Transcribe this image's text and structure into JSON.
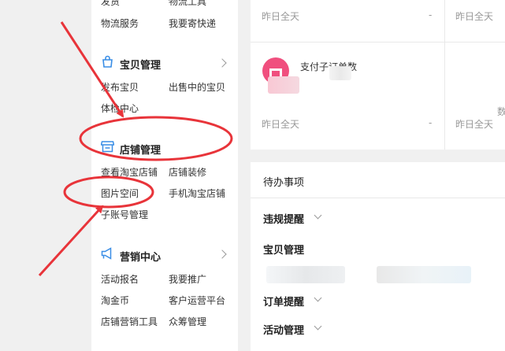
{
  "sidebar": {
    "top_row": {
      "left": "发货",
      "right": "物流工具"
    },
    "logistics_row": {
      "left": "物流服务",
      "right": "我要寄快递"
    },
    "product_mgmt": {
      "title": "宝贝管理",
      "links": [
        "发布宝贝",
        "出售中的宝贝",
        "体检中心"
      ]
    },
    "store_mgmt": {
      "title": "店铺管理",
      "links": [
        "查看淘宝店铺",
        "店铺装修",
        "图片空间",
        "手机淘宝店铺",
        "子账号管理"
      ]
    },
    "marketing": {
      "title": "营销中心",
      "links": [
        "活动报名",
        "我要推广",
        "淘金币",
        "客户运营平台",
        "店铺营销工具",
        "众筹管理"
      ]
    }
  },
  "stats": {
    "yesterday_label_1": "昨日全天",
    "dash_1": "-",
    "yesterday_label_2": "昨日全天",
    "metric_title": "支付子订单数",
    "yesterday_label_3": "昨日全天",
    "dash_3": "-",
    "yesterday_label_4": "昨日全天",
    "side_char": "数"
  },
  "todo": {
    "title": "待办事项",
    "items": [
      "违规提醒",
      "宝贝管理",
      "订单提醒",
      "活动管理"
    ]
  },
  "colors": {
    "accent_blue": "#3a8ee6",
    "annotation_red": "#e8343a",
    "avatar_pink": "#f04f7e"
  }
}
